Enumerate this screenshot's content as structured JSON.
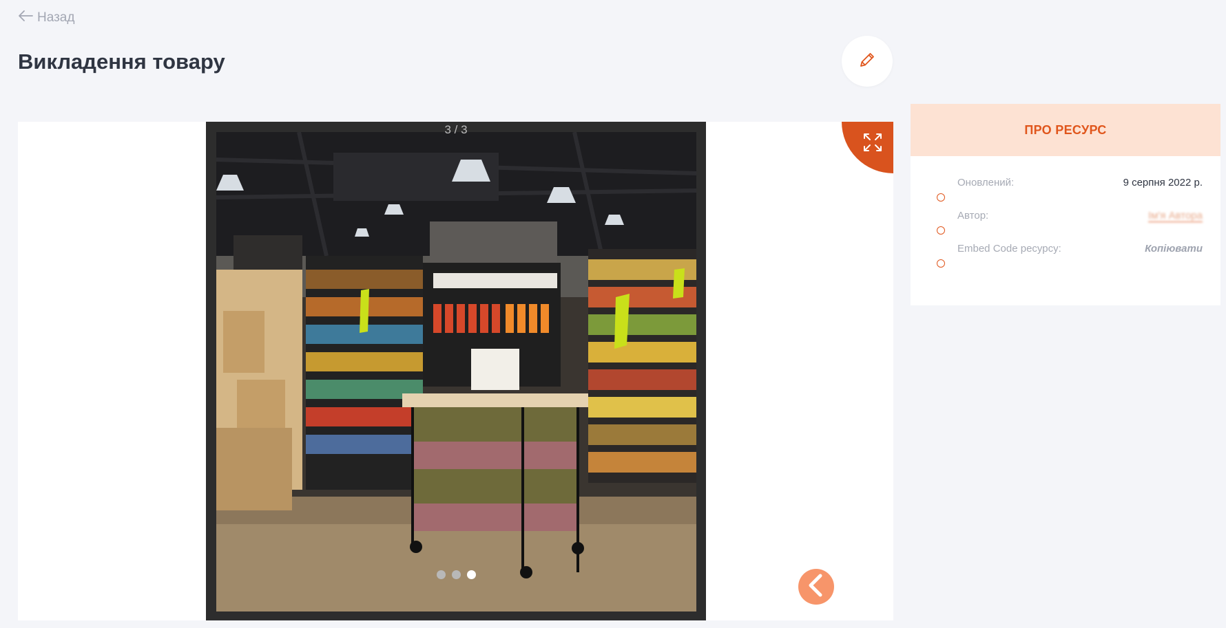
{
  "nav": {
    "back_label": "Назад"
  },
  "page": {
    "title": "Викладення товару"
  },
  "viewer": {
    "counter": "3 / 3",
    "slides_total": 3,
    "active_slide": 3,
    "image_description_icon": "photo"
  },
  "info": {
    "header": "ПРО РЕСУРС",
    "rows": [
      {
        "label": "Оновлений:",
        "value": "9 серпня 2022 р."
      },
      {
        "label": "Автор:",
        "value": "Ім'я Автора"
      },
      {
        "label": "Embed Code ресурсу:",
        "value": "Копіювати"
      }
    ]
  },
  "colors": {
    "accent": "#d9531e",
    "accent_light": "#fde2d3",
    "prev_button": "#f7956a",
    "background": "#f4f5f9"
  }
}
